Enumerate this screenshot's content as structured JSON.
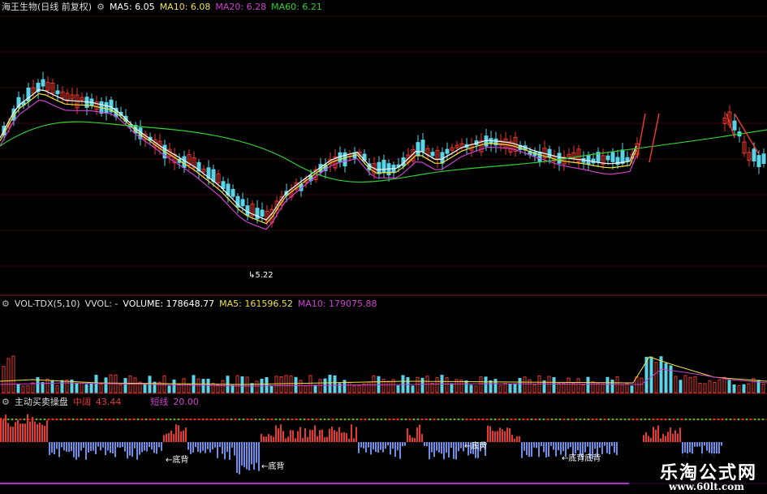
{
  "colors": {
    "up": "#e8392f",
    "down": "#5bd3e8",
    "ma5": "#ffffff",
    "ma10": "#f0e040",
    "ma20": "#d040d0",
    "ma60": "#30d030",
    "divider": "#8a1c1c",
    "bar_blue": "#6b8fe8"
  },
  "price_panel": {
    "title": "海王生物(日线 前复权)",
    "gear_icon": "gear-icon",
    "ma5_label": "MA5: 6.05",
    "ma10_label": "MA10: 6.08",
    "ma20_label": "MA20: 6.28",
    "ma60_label": "MA60: 6.21",
    "low_marker": "5.22"
  },
  "volume_panel": {
    "indicator": "VOL-TDX(5,10)",
    "vvol": "VVOL: -",
    "volume": "VOLUME: 178648.77",
    "ma5": "MA5: 161596.52",
    "ma10": "MA10: 179075.88"
  },
  "indicator_panel": {
    "title": "主动买卖操盘",
    "mid_label": "中阔",
    "mid_value": "43.44",
    "short_label": "短线",
    "short_value": "20.00",
    "annotations": [
      "底背",
      "底背",
      "底背",
      "底背底背"
    ]
  },
  "watermark": {
    "line1": "乐淘公式网",
    "line2": "www.60lt.com"
  }
}
